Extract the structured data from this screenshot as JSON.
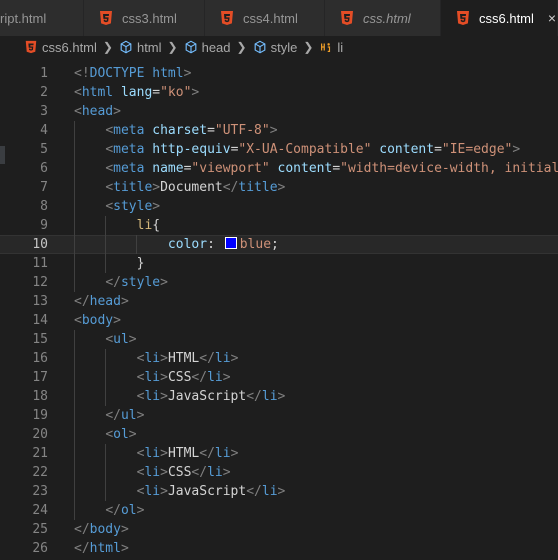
{
  "tabs": [
    {
      "label": "ript.html",
      "active": false,
      "italic": false,
      "icon": "none"
    },
    {
      "label": "css3.html",
      "active": false,
      "italic": false,
      "icon": "html5-icon"
    },
    {
      "label": "css4.html",
      "active": false,
      "italic": false,
      "icon": "html5-icon"
    },
    {
      "label": "css.html",
      "active": false,
      "italic": true,
      "icon": "html5-icon"
    },
    {
      "label": "css6.html",
      "active": true,
      "italic": false,
      "icon": "html5-icon",
      "close": "×"
    }
  ],
  "breadcrumb": [
    "css6.html",
    "html",
    "head",
    "style",
    "li"
  ],
  "current_line": 10,
  "colors": {
    "accent_html5": "#e44d26",
    "swatch_blue": "#0000ff"
  },
  "lines": [
    "<!DOCTYPE html>",
    "<html lang=\"ko\">",
    "<head>",
    "    <meta charset=\"UTF-8\">",
    "    <meta http-equiv=\"X-UA-Compatible\" content=\"IE=edge\">",
    "    <meta name=\"viewport\" content=\"width=device-width, initial",
    "    <title>Document</title>",
    "    <style>",
    "        li{",
    "            color: blue;",
    "        }",
    "    </style>",
    "</head>",
    "<body>",
    "    <ul>",
    "        <li>HTML</li>",
    "        <li>CSS</li>",
    "        <li>JavaScript</li>",
    "    </ul>",
    "    <ol>",
    "        <li>HTML</li>",
    "        <li>CSS</li>",
    "        <li>JavaScript</li>",
    "    </ol>",
    "</body>",
    "</html>"
  ]
}
